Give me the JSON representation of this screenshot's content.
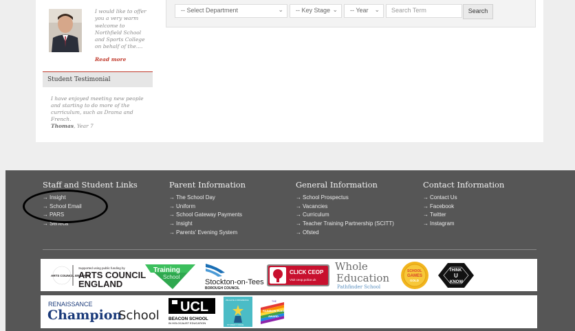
{
  "sidebar": {
    "greeting_text": "I would like to offer you a very warm welcome to Northfield School and Sports College on behalf of the....",
    "read_more": "Read more",
    "testimonial_heading": "Student Testimonial",
    "testimonial_text": "I have enjoyed meeting new people and starting to do more of the curriculum, such as Drama and French.",
    "testimonial_author_name": "Thomas",
    "testimonial_author_year": ", Year 7"
  },
  "filters": {
    "department": "-- Select Department",
    "key_stage": "-- Key Stage",
    "year": "-- Year",
    "search_placeholder": "Search Term",
    "search_button": "Search"
  },
  "footer": {
    "columns": [
      {
        "title": "Staff and Student Links",
        "items": [
          "Insight",
          "School Email",
          "PARS",
          "Seneca"
        ]
      },
      {
        "title": "Parent Information",
        "items": [
          "The School Day",
          "Uniform",
          "School Gateway Payments",
          "Insight",
          "Parents' Evening System"
        ]
      },
      {
        "title": "General Information",
        "items": [
          "School Prospectus",
          "Vacancies",
          "Curriculum",
          "Teacher Training Partnership (SCITT)",
          "Ofsted"
        ]
      },
      {
        "title": "Contact Information",
        "items": [
          "Contact Us",
          "Facebook",
          "Twitter",
          "Instagram"
        ]
      }
    ]
  },
  "logos": {
    "arts_council_small": "Supported using public funding by",
    "arts_council_line1": "ARTS COUNCIL",
    "arts_council_line2": "ENGLAND",
    "arts_council_ring": "ARTS COUNCIL ENGLAND",
    "training_school": "Training",
    "training_school_sub": "School",
    "stockton_line1": "Stockton-on-Tees",
    "stockton_line2": "BOROUGH COUNCIL",
    "ceop_title": "CLICK CEOP",
    "ceop_sub": "Visit ceop.police.uk",
    "whole_line1": "Whole",
    "whole_line2": "Education",
    "whole_line3": "Pathfinder School",
    "school_games_line1": "SCHOOL",
    "school_games_line2": "GAMES",
    "school_games_line3": "GOLD",
    "think_line1": "THINK",
    "think_line2": "U",
    "think_line3": "KNOW",
    "renaissance": "RENAISSANCE",
    "champion": "Champion",
    "school": "School",
    "ucl": "UCL",
    "beacon_line1": "BEACON SCHOOL",
    "beacon_line2": "IN HOLOCAUST EDUCATION",
    "award1_top": "WE HAVE A DIFFERENCE",
    "award1_bottom": "STUDENT VOICE",
    "rainbow_line1": "THE",
    "rainbow_line2": "RAINBOW FLAG",
    "rainbow_line3": "AWARD"
  },
  "colors": {
    "accent_red": "#c0392b",
    "footer_bg": "#565656",
    "arts_council_text": "#231f20",
    "training_green": "#2fa84f",
    "stockton_blue": "#1b6fb5",
    "ceop_red": "#c8102e",
    "whole_text": "#6b6b6b",
    "renaissance_blue": "#1a3a7a"
  }
}
